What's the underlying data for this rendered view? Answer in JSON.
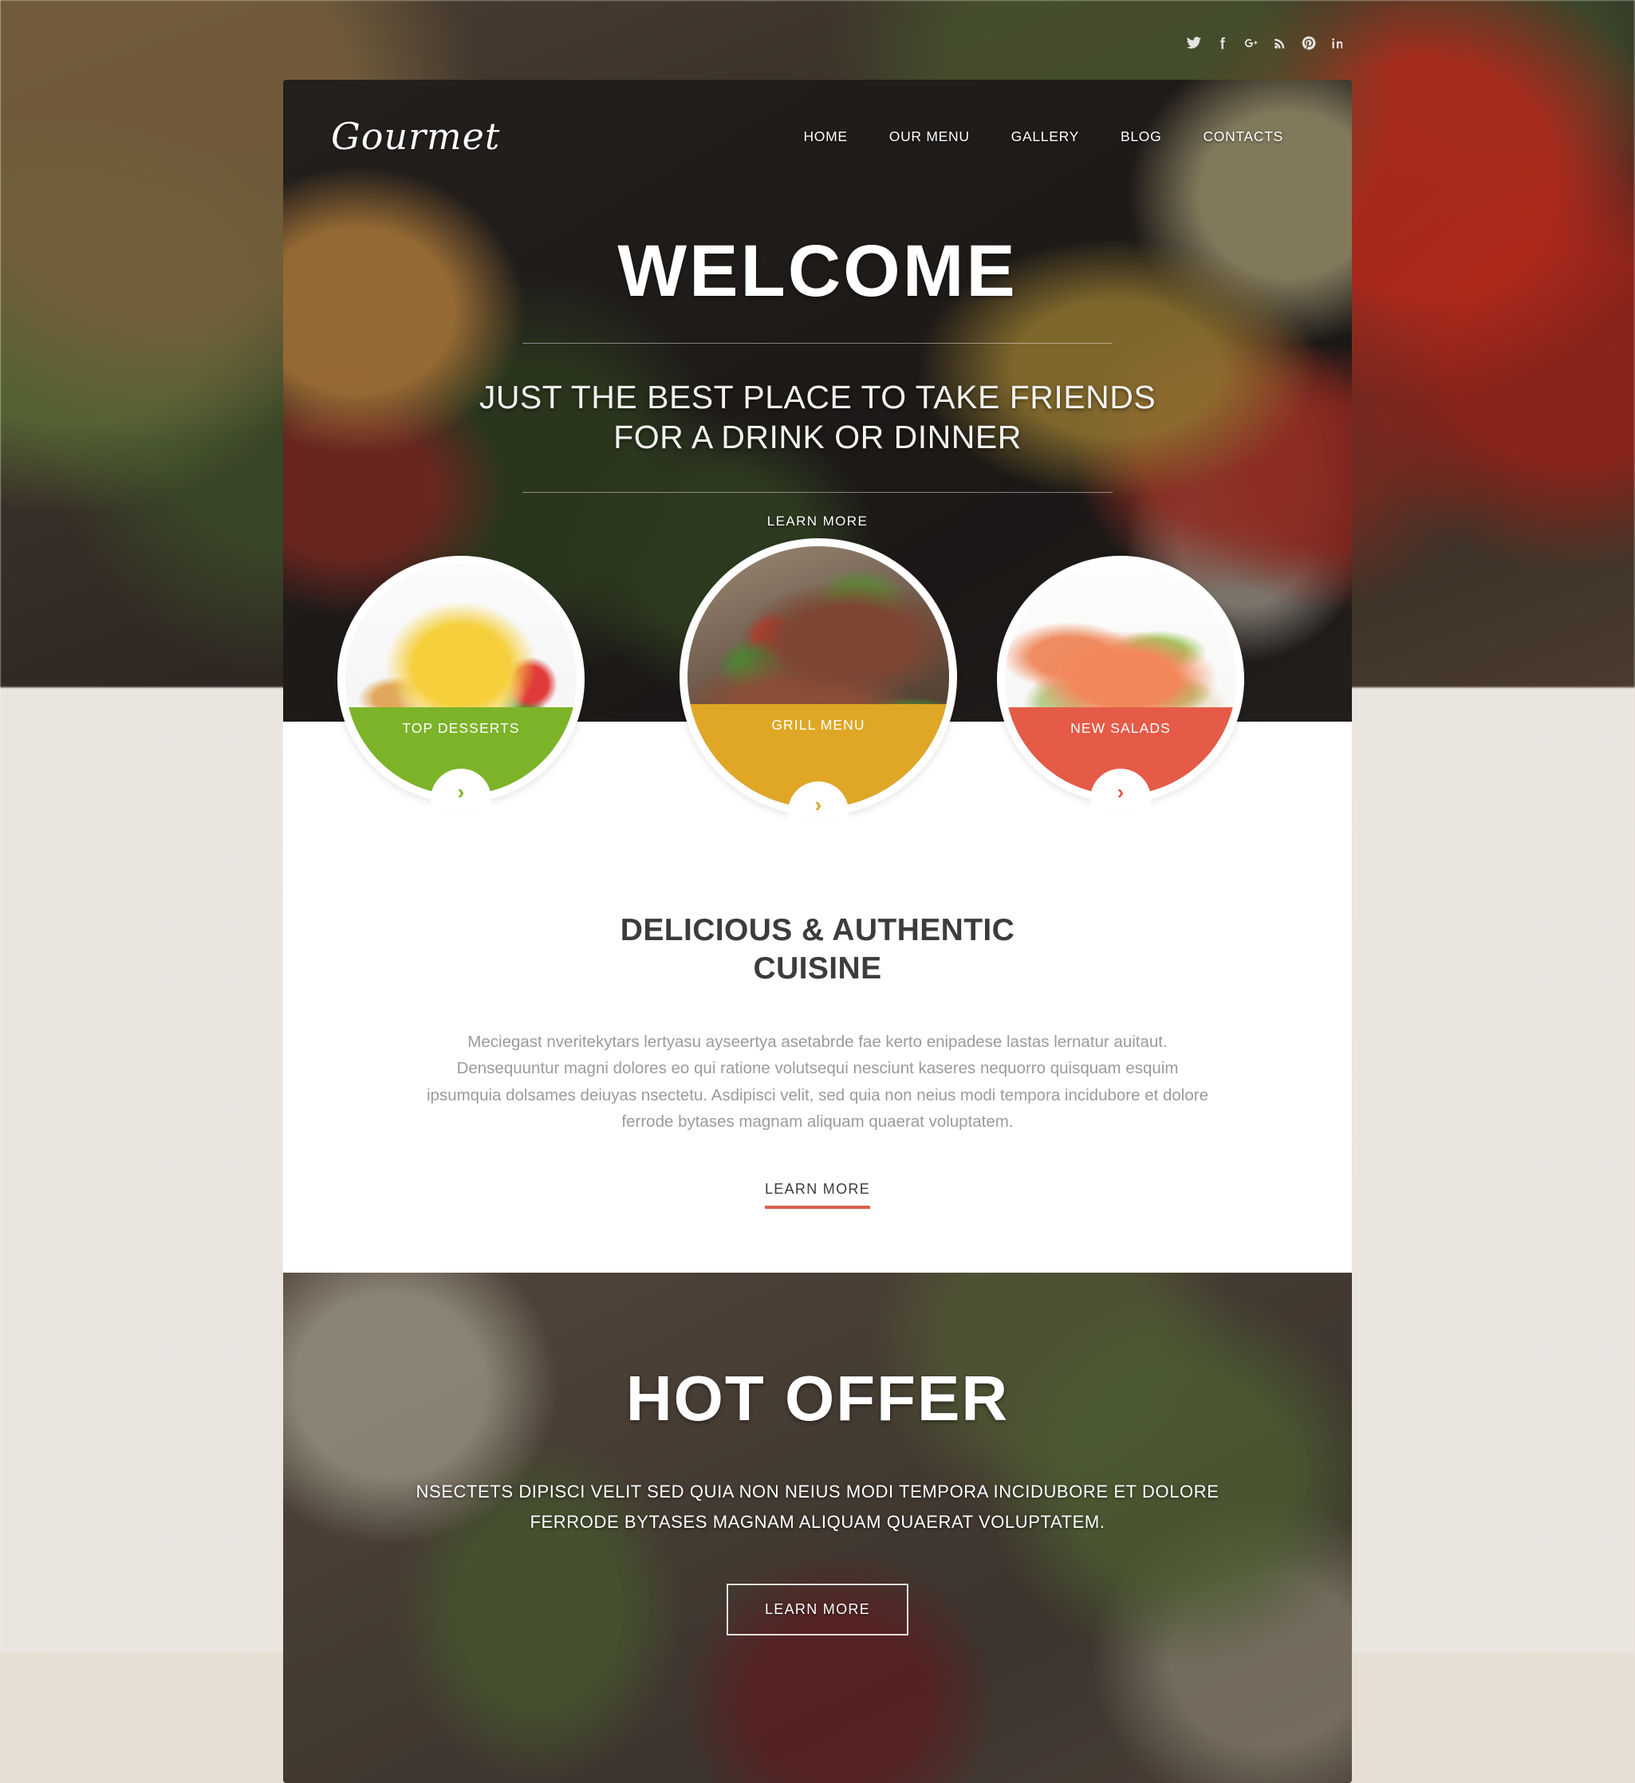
{
  "site": {
    "logo": "Gourmet",
    "accent_green": "#7cb328",
    "accent_yellow": "#e0a726",
    "accent_red": "#e55b47",
    "accent_underline": "#d9604e"
  },
  "social": [
    {
      "name": "twitter-icon",
      "label": "Twitter"
    },
    {
      "name": "facebook-icon",
      "label": "Facebook"
    },
    {
      "name": "google-plus-icon",
      "label": "Google Plus"
    },
    {
      "name": "rss-icon",
      "label": "RSS"
    },
    {
      "name": "pinterest-icon",
      "label": "Pinterest"
    },
    {
      "name": "linkedin-icon",
      "label": "LinkedIn"
    }
  ],
  "nav": {
    "items": [
      {
        "label": "HOME"
      },
      {
        "label": "OUR MENU"
      },
      {
        "label": "GALLERY"
      },
      {
        "label": "BLOG"
      },
      {
        "label": "CONTACTS"
      }
    ]
  },
  "hero": {
    "title": "WELCOME",
    "subtitle_line1": "JUST THE BEST PLACE TO TAKE FRIENDS",
    "subtitle_line2": "FOR A DRINK OR DINNER",
    "learn_more": "LEARN MORE"
  },
  "cards": [
    {
      "label": "TOP DESSERTS",
      "color": "#7cb328",
      "arrow": "›"
    },
    {
      "label": "GRILL MENU",
      "color": "#e0a726",
      "arrow": "›"
    },
    {
      "label": "NEW SALADS",
      "color": "#e55b47",
      "arrow": "›"
    }
  ],
  "cuisine": {
    "title_line1": "DELICIOUS & AUTHENTIC",
    "title_line2": "CUISINE",
    "paragraph": "Meciegast nveritekytars lertyasu ayseertya asetabrde fae kerto enipadese lastas lernatur auitaut. Densequuntur magni dolores eo qui ratione volutsequi nesciunt kaseres nequorro quisquam esquim ipsumquia dolsames deiuyas nsectetu. Asdipisci velit, sed quia non neius modi tempora incidubore et dolore ferrode bytases magnam aliquam quaerat voluptatem.",
    "learn_more": "LEARN MORE"
  },
  "offer": {
    "title": "HOT OFFER",
    "line1": "NSECTETS DIPISCI VELIT SED QUIA NON NEIUS MODI TEMPORA INCIDUBORE ET DOLORE",
    "line2": "FERRODE BYTASES MAGNAM ALIQUAM QUAERAT VOLUPTATEM.",
    "learn_more": "LEARN MORE"
  }
}
